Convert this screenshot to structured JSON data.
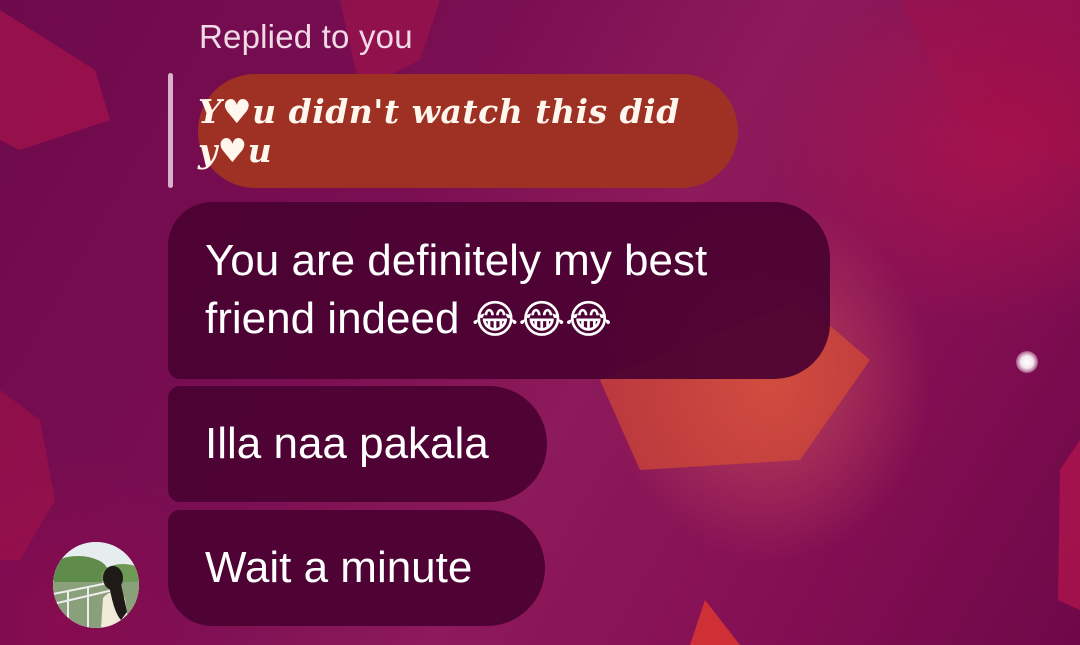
{
  "reply_header": {
    "label": "Replied to you"
  },
  "quoted_message": {
    "text": "Y♥u didn't watch this did y♥u"
  },
  "messages": [
    {
      "text": "You are definitely my best friend indeed",
      "emoji": "😂😂😂"
    },
    {
      "text": "Illa naa pakala"
    },
    {
      "text": "Wait a minute"
    }
  ],
  "sender": {
    "avatar_icon": "profile-photo-avatar"
  },
  "colors": {
    "background": "#7a0e52",
    "bubble": "#4a0232",
    "quoted_bubble": "#9f3124"
  }
}
